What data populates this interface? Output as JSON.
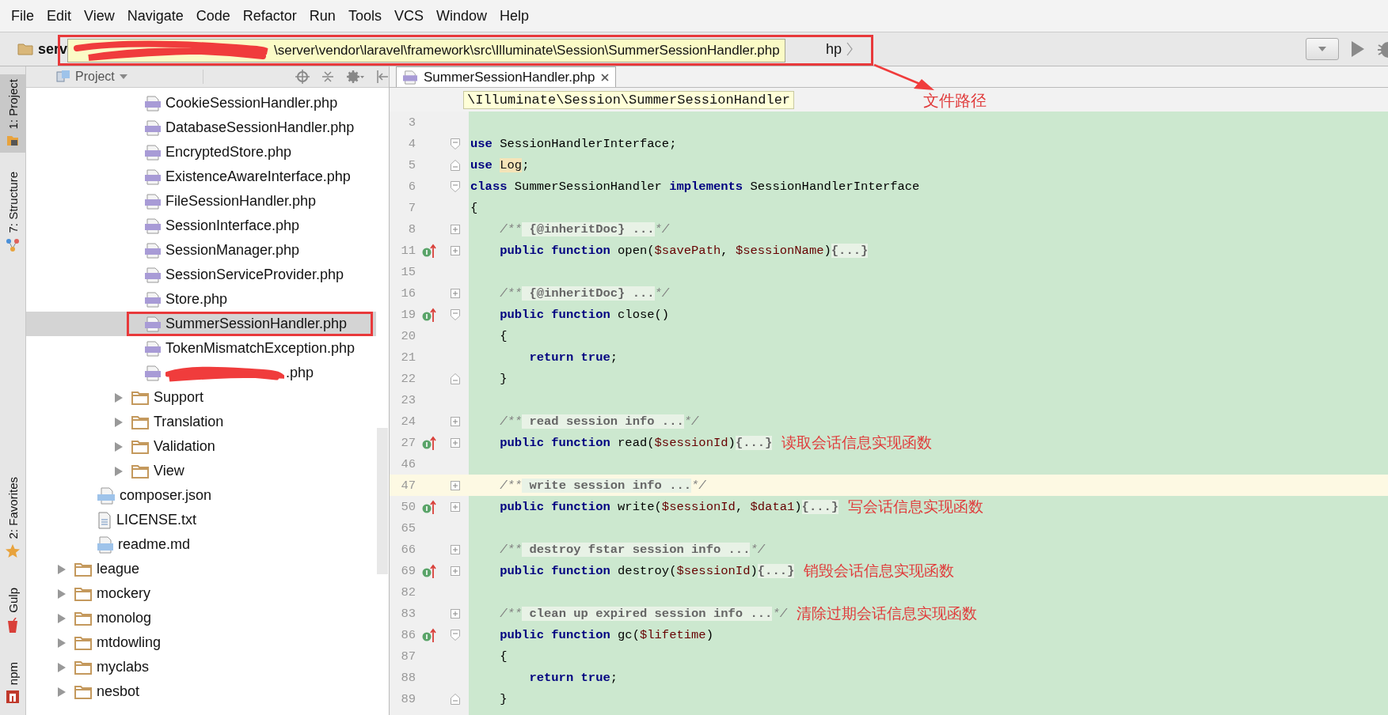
{
  "menu": [
    "File",
    "Edit",
    "View",
    "Navigate",
    "Code",
    "Refactor",
    "Run",
    "Tools",
    "VCS",
    "Window",
    "Help"
  ],
  "toolbar": {
    "breadcrumb_start": "serv",
    "breadcrumb_end": "hp"
  },
  "path_tooltip": {
    "text": "\\server\\vendor\\laravel\\framework\\src\\Illuminate\\Session\\SummerSessionHandler.php"
  },
  "annotation": {
    "label": "文件路径"
  },
  "side_tools_top": [
    {
      "label": "1: Project",
      "kind": "project",
      "selected": true
    },
    {
      "label": "7: Structure",
      "kind": "structure",
      "selected": false
    }
  ],
  "side_tools_bottom": [
    {
      "label": "2: Favorites",
      "kind": "favorites",
      "selected": false
    },
    {
      "label": "Gulp",
      "kind": "gulp",
      "selected": false
    },
    {
      "label": "npm",
      "kind": "npm",
      "selected": false
    }
  ],
  "project_panel": {
    "title": "Project",
    "tree": [
      {
        "children": [
          {
            "children": [
              {
                "children": [
                  {
                    "label": "CookieSessionHandler.php",
                    "kind": "php",
                    "selected": false
                  },
                  {
                    "label": "DatabaseSessionHandler.php",
                    "kind": "php",
                    "selected": false
                  },
                  {
                    "label": "EncryptedStore.php",
                    "kind": "php",
                    "selected": false
                  },
                  {
                    "label": "ExistenceAwareInterface.php",
                    "kind": "php",
                    "selected": false
                  },
                  {
                    "label": "FileSessionHandler.php",
                    "kind": "php",
                    "selected": false
                  },
                  {
                    "label": "SessionInterface.php",
                    "kind": "php",
                    "selected": false
                  },
                  {
                    "label": "SessionManager.php",
                    "kind": "php",
                    "selected": false
                  },
                  {
                    "label": "SessionServiceProvider.php",
                    "kind": "php",
                    "selected": false
                  },
                  {
                    "label": "Store.php",
                    "kind": "php",
                    "selected": false
                  },
                  {
                    "label": "SummerSessionHandler.php",
                    "kind": "php",
                    "selected": true
                  },
                  {
                    "label": "TokenMismatchException.php",
                    "kind": "php",
                    "selected": false
                  },
                  {
                    "label": ".php",
                    "kind": "php",
                    "selected": false,
                    "redacted": true
                  }
                ]
              },
              {
                "label": "Support",
                "kind": "folder",
                "selected": false,
                "expanded": false
              },
              {
                "label": "Translation",
                "kind": "folder",
                "selected": false,
                "expanded": false
              },
              {
                "label": "Validation",
                "kind": "folder",
                "selected": false,
                "expanded": false
              },
              {
                "label": "View",
                "kind": "folder",
                "selected": false,
                "expanded": false
              }
            ]
          },
          {
            "label": "composer.json",
            "kind": "json",
            "selected": false
          },
          {
            "label": "LICENSE.txt",
            "kind": "txt",
            "selected": false
          },
          {
            "label": "readme.md",
            "kind": "md",
            "selected": false
          }
        ]
      },
      {
        "label": "league",
        "kind": "folder",
        "selected": false,
        "expanded": false
      },
      {
        "label": "mockery",
        "kind": "folder",
        "selected": false,
        "expanded": false
      },
      {
        "label": "monolog",
        "kind": "folder",
        "selected": false,
        "expanded": false
      },
      {
        "label": "mtdowling",
        "kind": "folder",
        "selected": false,
        "expanded": false
      },
      {
        "label": "myclabs",
        "kind": "folder",
        "selected": false,
        "expanded": false
      },
      {
        "label": "nesbot",
        "kind": "folder",
        "selected": false,
        "expanded": false
      }
    ]
  },
  "editor": {
    "tabs": [
      {
        "label": "SummerSessionHandler.php",
        "selected": true
      }
    ],
    "breadcrumb_tooltip": "\\Illuminate\\Session\\SummerSessionHandler",
    "lines": [
      {
        "number": "3",
        "marker": false,
        "current": false,
        "kind": "plain"
      },
      {
        "number": "4",
        "marker": false,
        "current": false,
        "kind": "fold-start",
        "tokens": [
          {
            "t": "use",
            "kind": "keyword"
          },
          {
            "t": " SessionHandlerInterface;",
            "kind": "name"
          }
        ]
      },
      {
        "number": "5",
        "marker": false,
        "current": false,
        "kind": "fold-end",
        "tokens": [
          {
            "t": "use ",
            "kind": "keyword"
          },
          {
            "t": "Log",
            "kind": "reference"
          },
          {
            "t": ";",
            "kind": "name"
          }
        ]
      },
      {
        "number": "6",
        "marker": false,
        "current": false,
        "kind": "fold-start",
        "tokens": [
          {
            "t": "class",
            "kind": "keyword"
          },
          {
            "t": " SummerSessionHandler ",
            "kind": "name"
          },
          {
            "t": "implements",
            "kind": "keyword"
          },
          {
            "t": " SessionHandlerInterface",
            "kind": "name"
          }
        ]
      },
      {
        "number": "7",
        "marker": false,
        "current": false,
        "kind": "plain",
        "tokens": [
          {
            "t": "{",
            "kind": "name"
          }
        ]
      },
      {
        "number": "8",
        "marker": false,
        "current": false,
        "kind": "folded",
        "tokens": [
          {
            "t": "    /**",
            "kind": "comment"
          },
          {
            "t": " {@inheritDoc} ...",
            "kind": "folded"
          },
          {
            "t": "*/",
            "kind": "comment"
          }
        ]
      },
      {
        "number": "11",
        "marker": true,
        "current": false,
        "kind": "folded",
        "tokens": [
          {
            "t": "    public function",
            "kind": "keyword"
          },
          {
            "t": " open(",
            "kind": "name"
          },
          {
            "t": "$savePath",
            "kind": "variable"
          },
          {
            "t": ", ",
            "kind": "name"
          },
          {
            "t": "$sessionName",
            "kind": "variable"
          },
          {
            "t": ")",
            "kind": "name"
          },
          {
            "t": "{...}",
            "kind": "folded"
          }
        ]
      },
      {
        "number": "15",
        "marker": false,
        "current": false,
        "kind": "plain"
      },
      {
        "number": "16",
        "marker": false,
        "current": false,
        "kind": "folded",
        "tokens": [
          {
            "t": "    /**",
            "kind": "comment"
          },
          {
            "t": " {@inheritDoc} ...",
            "kind": "folded"
          },
          {
            "t": "*/",
            "kind": "comment"
          }
        ]
      },
      {
        "number": "19",
        "marker": true,
        "current": false,
        "kind": "fold-start",
        "tokens": [
          {
            "t": "    public function",
            "kind": "keyword"
          },
          {
            "t": " close()",
            "kind": "name"
          }
        ]
      },
      {
        "number": "20",
        "marker": false,
        "current": false,
        "kind": "plain",
        "tokens": [
          {
            "t": "    {",
            "kind": "name"
          }
        ]
      },
      {
        "number": "21",
        "marker": false,
        "current": false,
        "kind": "plain",
        "tokens": [
          {
            "t": "        return true",
            "kind": "keyword"
          },
          {
            "t": ";",
            "kind": "name"
          }
        ]
      },
      {
        "number": "22",
        "marker": false,
        "current": false,
        "kind": "fold-end",
        "tokens": [
          {
            "t": "    }",
            "kind": "name"
          }
        ]
      },
      {
        "number": "23",
        "marker": false,
        "current": false,
        "kind": "plain"
      },
      {
        "number": "24",
        "marker": false,
        "current": false,
        "kind": "folded",
        "tokens": [
          {
            "t": "    /**",
            "kind": "comment"
          },
          {
            "t": " read session info ...",
            "kind": "folded"
          },
          {
            "t": "*/",
            "kind": "comment"
          }
        ]
      },
      {
        "number": "27",
        "marker": true,
        "current": false,
        "kind": "folded",
        "note": "读取会话信息实现函数",
        "tokens": [
          {
            "t": "    public function",
            "kind": "keyword"
          },
          {
            "t": " read(",
            "kind": "name"
          },
          {
            "t": "$sessionId",
            "kind": "variable"
          },
          {
            "t": ")",
            "kind": "name"
          },
          {
            "t": "{...}",
            "kind": "folded"
          }
        ]
      },
      {
        "number": "46",
        "marker": false,
        "current": false,
        "kind": "plain"
      },
      {
        "number": "47",
        "marker": false,
        "current": true,
        "kind": "folded",
        "tokens": [
          {
            "t": "    /**",
            "kind": "comment"
          },
          {
            "t": " write session info ...",
            "kind": "folded"
          },
          {
            "t": "*/",
            "kind": "comment"
          }
        ]
      },
      {
        "number": "50",
        "marker": true,
        "current": false,
        "kind": "folded",
        "note": "写会话信息实现函数",
        "tokens": [
          {
            "t": "    public function",
            "kind": "keyword"
          },
          {
            "t": " write(",
            "kind": "name"
          },
          {
            "t": "$sessionId",
            "kind": "variable"
          },
          {
            "t": ", ",
            "kind": "name"
          },
          {
            "t": "$data1",
            "kind": "variable"
          },
          {
            "t": ")",
            "kind": "name"
          },
          {
            "t": "{...}",
            "kind": "folded"
          }
        ]
      },
      {
        "number": "65",
        "marker": false,
        "current": false,
        "kind": "plain"
      },
      {
        "number": "66",
        "marker": false,
        "current": false,
        "kind": "folded",
        "tokens": [
          {
            "t": "    /**",
            "kind": "comment"
          },
          {
            "t": " destroy fstar session info ...",
            "kind": "folded"
          },
          {
            "t": "*/",
            "kind": "comment"
          }
        ]
      },
      {
        "number": "69",
        "marker": true,
        "current": false,
        "kind": "folded",
        "note": "销毁会话信息实现函数",
        "tokens": [
          {
            "t": "    public function",
            "kind": "keyword"
          },
          {
            "t": " destroy(",
            "kind": "name"
          },
          {
            "t": "$sessionId",
            "kind": "variable"
          },
          {
            "t": ")",
            "kind": "name"
          },
          {
            "t": "{...}",
            "kind": "folded"
          }
        ]
      },
      {
        "number": "82",
        "marker": false,
        "current": false,
        "kind": "plain"
      },
      {
        "number": "83",
        "marker": false,
        "current": false,
        "kind": "folded",
        "note": "清除过期会话信息实现函数",
        "tokens": [
          {
            "t": "    /**",
            "kind": "comment"
          },
          {
            "t": " clean up expired session info ...",
            "kind": "folded"
          },
          {
            "t": "*/",
            "kind": "comment"
          }
        ]
      },
      {
        "number": "86",
        "marker": true,
        "current": false,
        "kind": "fold-start",
        "tokens": [
          {
            "t": "    public function",
            "kind": "keyword"
          },
          {
            "t": " gc(",
            "kind": "name"
          },
          {
            "t": "$lifetime",
            "kind": "variable"
          },
          {
            "t": ")",
            "kind": "name"
          }
        ]
      },
      {
        "number": "87",
        "marker": false,
        "current": false,
        "kind": "plain",
        "tokens": [
          {
            "t": "    {",
            "kind": "name"
          }
        ]
      },
      {
        "number": "88",
        "marker": false,
        "current": false,
        "kind": "plain",
        "tokens": [
          {
            "t": "        return true",
            "kind": "keyword"
          },
          {
            "t": ";",
            "kind": "name"
          }
        ]
      },
      {
        "number": "89",
        "marker": false,
        "current": false,
        "kind": "fold-end",
        "tokens": [
          {
            "t": "    }",
            "kind": "name"
          }
        ]
      }
    ]
  }
}
